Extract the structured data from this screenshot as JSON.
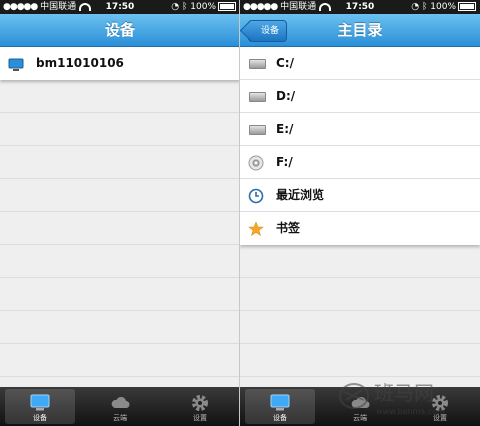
{
  "status_bar": {
    "carrier": "中国联通",
    "time": "17:50",
    "battery": "100%"
  },
  "left_screen": {
    "nav_title": "设备",
    "devices": [
      {
        "name": "bm11010106",
        "icon": "monitor-icon"
      }
    ],
    "tabs": [
      {
        "label": "设备",
        "icon": "monitor-icon",
        "selected": true
      },
      {
        "label": "云端",
        "icon": "cloud-icon",
        "selected": false
      },
      {
        "label": "设置",
        "icon": "gear-icon",
        "selected": false
      }
    ]
  },
  "right_screen": {
    "back_label": "设备",
    "nav_title": "主目录",
    "items": [
      {
        "label": "C:/",
        "icon": "drive-icon"
      },
      {
        "label": "D:/",
        "icon": "drive-icon"
      },
      {
        "label": "E:/",
        "icon": "drive-icon"
      },
      {
        "label": "F:/",
        "icon": "cd-icon"
      },
      {
        "label": "最近浏览",
        "icon": "clock-icon"
      },
      {
        "label": "书签",
        "icon": "star-icon"
      }
    ],
    "tabs": [
      {
        "label": "设备",
        "icon": "monitor-icon",
        "selected": true
      },
      {
        "label": "云端",
        "icon": "cloud-icon",
        "selected": false
      },
      {
        "label": "设置",
        "icon": "gear-icon",
        "selected": false
      }
    ]
  },
  "watermark": {
    "brand": "班马网",
    "url": "www.banma.com"
  },
  "colors": {
    "nav_gradient_top": "#6cc1ef",
    "nav_gradient_bottom": "#2a8fd8",
    "star": "#f5a623",
    "clock": "#2b6cb0"
  }
}
